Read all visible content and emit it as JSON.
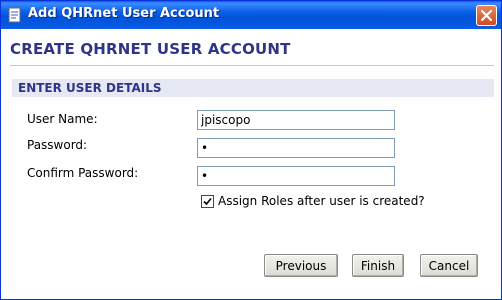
{
  "window": {
    "title": "Add QHRnet User Account"
  },
  "page": {
    "heading": "CREATE QHRNET USER ACCOUNT"
  },
  "section": {
    "title": "ENTER USER DETAILS"
  },
  "form": {
    "username_label": "User Name:",
    "username_value": "jpiscopo",
    "password_label": "Password:",
    "password_value": "x",
    "confirm_label": "Confirm Password:",
    "confirm_value": "x",
    "assign_roles_label": "Assign Roles after user is created?",
    "assign_roles_checked": true
  },
  "buttons": {
    "previous": "Previous",
    "finish": "Finish",
    "cancel": "Cancel"
  },
  "icons": {
    "app": "document-icon",
    "close": "close-icon",
    "check": "checkmark-icon"
  },
  "colors": {
    "titlebar": "#0a5ce8",
    "heading": "#2e3486",
    "section_bg": "#e6e8f4",
    "close": "#d24a1e"
  }
}
